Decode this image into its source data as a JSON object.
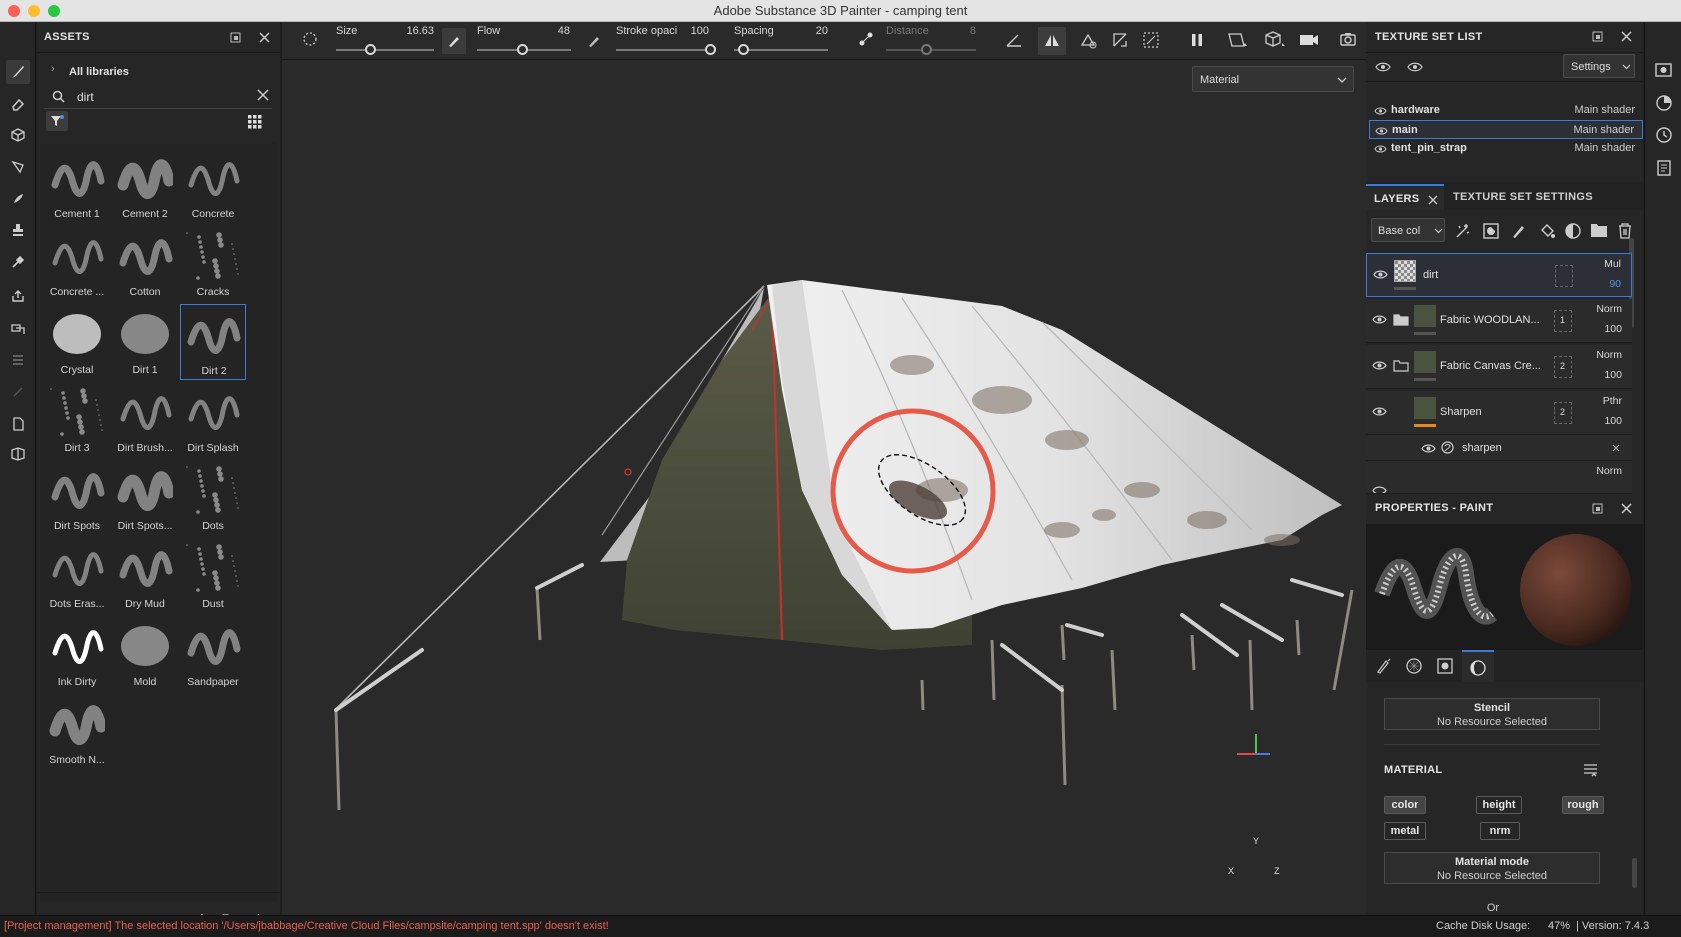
{
  "window": {
    "title": "Adobe Substance 3D Painter - camping tent"
  },
  "assets": {
    "title": "ASSETS",
    "breadcrumb": "All libraries",
    "search_value": "dirt",
    "items": [
      {
        "label": "Cement 1"
      },
      {
        "label": "Cement 2"
      },
      {
        "label": "Concrete"
      },
      {
        "label": "Concrete ..."
      },
      {
        "label": "Cotton"
      },
      {
        "label": "Cracks"
      },
      {
        "label": "Crystal"
      },
      {
        "label": "Dirt 1"
      },
      {
        "label": "Dirt 2"
      },
      {
        "label": "Dirt 3"
      },
      {
        "label": "Dirt Brush..."
      },
      {
        "label": "Dirt Splash"
      },
      {
        "label": "Dirt Spots"
      },
      {
        "label": "Dirt Spots..."
      },
      {
        "label": "Dots"
      },
      {
        "label": "Dots Eras..."
      },
      {
        "label": "Dry Mud"
      },
      {
        "label": "Dust"
      },
      {
        "label": "Ink Dirty"
      },
      {
        "label": "Mold"
      },
      {
        "label": "Sandpaper"
      },
      {
        "label": "Smooth N..."
      }
    ],
    "selected_item": "Dirt 2"
  },
  "toolbar": {
    "size_label": "Size",
    "size_value": "16.63",
    "size_fraction": 0.35,
    "flow_label": "Flow",
    "flow_value": "48",
    "flow_fraction": 0.48,
    "stroke_label": "Stroke opaci",
    "stroke_value": "100",
    "stroke_fraction": 1.0,
    "spacing_label": "Spacing",
    "spacing_value": "20",
    "spacing_fraction": 0.1,
    "distance_label": "Distance",
    "distance_value": "8",
    "distance_fraction": 0.45
  },
  "viewport": {
    "display_mode": "Material",
    "axis_y": "Y",
    "axis_x": "X",
    "axis_z": "Z"
  },
  "texture_set_list": {
    "title": "TEXTURE SET LIST",
    "settings_label": "Settings",
    "rows": [
      {
        "name": "hardware",
        "shader": "Main shader"
      },
      {
        "name": "main",
        "shader": "Main shader"
      },
      {
        "name": "tent_pin_strap",
        "shader": "Main shader"
      }
    ]
  },
  "layers": {
    "tab_layers": "LAYERS",
    "tab_texture_settings": "TEXTURE SET SETTINGS",
    "channel_select": "Base col",
    "items": [
      {
        "name": "dirt",
        "blend": "Mul",
        "opacity": "90"
      },
      {
        "name": "Fabric WOODLAN...",
        "blend": "Norm",
        "opacity": "100",
        "count": "1"
      },
      {
        "name": "Fabric Canvas Cre...",
        "blend": "Norm",
        "opacity": "100",
        "count": "2"
      },
      {
        "name": "Sharpen",
        "blend": "Pthr",
        "opacity": "100",
        "count": "2"
      }
    ],
    "sub_effect": "sharpen",
    "partial_blend": "Norm"
  },
  "properties": {
    "title": "PROPERTIES - PAINT",
    "stencil_title": "Stencil",
    "stencil_value": "No Resource Selected",
    "material_header": "MATERIAL",
    "channels": [
      "color",
      "height",
      "rough",
      "metal",
      "nrm"
    ],
    "material_mode_title": "Material mode",
    "material_mode_value": "No Resource Selected",
    "or_label": "Or"
  },
  "status": {
    "message": "[Project management] The selected location '/Users/jbabbage/Creative Cloud Files/campsite/camping tent.spp' doesn't exist!",
    "cache_label": "Cache Disk Usage:",
    "cache_value": "47%",
    "version": "| Version: 7.4.3",
    "error_color": "#e8604c"
  }
}
